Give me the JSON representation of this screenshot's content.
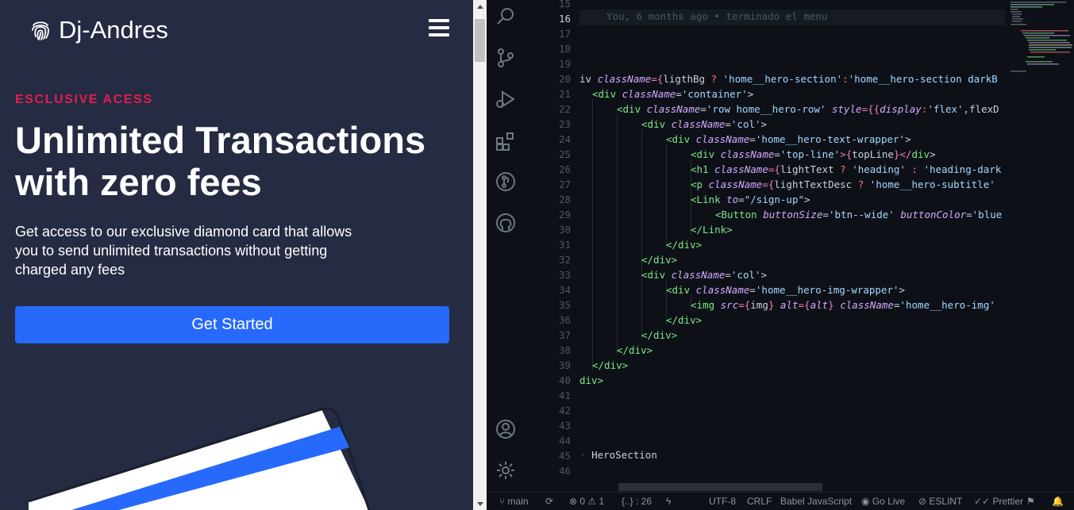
{
  "site": {
    "brand": "Dj-Andres",
    "topline": "ESCLUSIVE ACESS",
    "heading": "Unlimited Transactions with zero fees",
    "subtitle": "Get access to our exclusive diamond card that allows you to send unlimited transactions without getting charged any fees",
    "cta_label": "Get Started",
    "colors": {
      "bg": "#242b42",
      "accent": "#e31e4f",
      "button": "#276afb"
    }
  },
  "editor": {
    "blame": "You, 6 months ago • terminado el menu",
    "line_numbers": [
      "15",
      "16",
      "17",
      "18",
      "19",
      "20",
      "21",
      "22",
      "23",
      "24",
      "25",
      "26",
      "27",
      "28",
      "29",
      "30",
      "31",
      "32",
      "33",
      "34",
      "35",
      "36",
      "37",
      "38",
      "39",
      "40",
      "41",
      "42",
      "43",
      "44",
      "45",
      "46"
    ],
    "active_line": "16",
    "breadcrumb_line": "HeroSection",
    "code": {
      "l20": [
        "iv ",
        "className",
        "={",
        "ligthBg",
        " ? ",
        "'home__hero-section'",
        ":",
        "'home__hero-section darkB"
      ],
      "l21": [
        "<div ",
        "className",
        "=",
        "'container'",
        ">"
      ],
      "l22": [
        "<div ",
        "className",
        "=",
        "'row home__hero-row'",
        " style",
        "={{",
        "display",
        ":",
        "'flex'",
        ",flexD"
      ],
      "l23": [
        "<div ",
        "className",
        "=",
        "'col'",
        ">"
      ],
      "l24": [
        "<div ",
        "className",
        "=",
        "'home__hero-text-wrapper'",
        ">"
      ],
      "l25": [
        "<div ",
        "className",
        "=",
        "'top-line'",
        ">{",
        "topLine",
        "}</",
        "div",
        ">"
      ],
      "l26": [
        "<h1 ",
        "className",
        "={",
        "lightText",
        " ? ",
        "'heading'",
        " : ",
        "'heading-dark"
      ],
      "l27": [
        "<p ",
        "className",
        "={",
        "lightTextDesc",
        " ? ",
        "'home__hero-subtitle'"
      ],
      "l28": [
        "<Link ",
        "to",
        "=",
        "\"/sign-up\"",
        ">"
      ],
      "l29": [
        "<Button ",
        "buttonSize",
        "=",
        "'btn--wide'",
        " buttonColor",
        "=",
        "'blue"
      ],
      "l30": [
        "</Link>"
      ],
      "l31": [
        "</div>"
      ],
      "l32": [
        "</div>"
      ],
      "l33": [
        "<div ",
        "className",
        "=",
        "'col'",
        ">"
      ],
      "l34": [
        "<div ",
        "className",
        "=",
        "'home__hero-img-wrapper'",
        ">"
      ],
      "l35": [
        "<img ",
        "src",
        "={",
        "img",
        "} ",
        "alt",
        "={",
        "alt",
        "} ",
        "className",
        "=",
        "'home__hero-img'"
      ],
      "l36": [
        "</div>"
      ],
      "l37": [
        "</div>"
      ],
      "l38": [
        "</div>"
      ],
      "l39": [
        "</div>"
      ],
      "l40": [
        "div>"
      ]
    }
  },
  "status": {
    "branch": "main",
    "problems": "⊗ 0 ⚠ 1",
    "selection": "{..} : 26",
    "encoding": "UTF-8",
    "eol": "CRLF",
    "language": "Babel JavaScript",
    "golive": "Go Live",
    "eslint": "ESLINT",
    "prettier": "Prettier"
  }
}
